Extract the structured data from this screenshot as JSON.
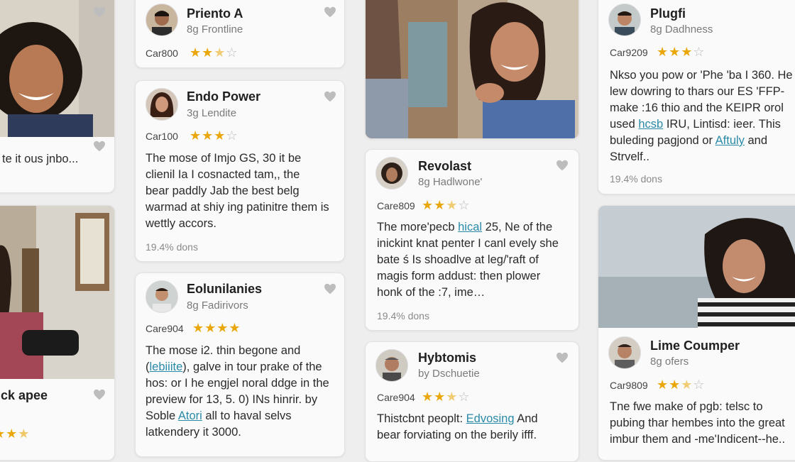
{
  "cards": {
    "a": {
      "name": "Priento A",
      "sub": "8g Frontline",
      "rate": "Car800",
      "stars": [
        1,
        1,
        0.5,
        0
      ]
    },
    "b": {
      "name": "Endo Power",
      "sub": "3g Lendite",
      "rate": "Car100",
      "stars": [
        1,
        1,
        1,
        0
      ],
      "body1": "The mose of Imjo GS, 30 it be",
      "body2": "clienil Ia I cosnacted tam,, the",
      "body3": "bear paddly Jab the best belg",
      "body4": "warmad at shiy ing patinitre them is",
      "body5": "wettly accors.",
      "meta": "19.4% dons"
    },
    "c": {
      "name": "Eolunilanies",
      "sub": "8g Fadirivors",
      "rate": "Care904",
      "stars": [
        1,
        1,
        1,
        1
      ],
      "body1": "The mose i2. thin begone and",
      "body2_link": "lebiiite",
      "body2_rest": "), galve in tour prake of the",
      "body3": "hos: or I he engjel noral ddge in the",
      "body4": "preview for 13, 5. 0) INs hinrir. by",
      "body5_pre": "Soble ",
      "body5_link": "Atori",
      "body5_rest": " all to haval selvs",
      "body6": "latkendery it 3000."
    },
    "d": {
      "name": "Revolast",
      "sub": "8g Hadlwone'",
      "rate": "Care809",
      "stars": [
        1,
        1,
        0.5,
        0
      ],
      "body1_pre": "The more'pecb ",
      "body1_link": "hical",
      "body1_rest": " 25, Ne of the",
      "body2": "inickint knat penter I canl evely she",
      "body3": "bate ś Is shoadlve at leg/'raft of",
      "body4": "magis form addust: then plower",
      "body5": "honk of the :7, ime…",
      "meta": "19.4% dons"
    },
    "e": {
      "name": "Hybtomis",
      "sub": "by Dschuetie",
      "rate": "Care904",
      "stars": [
        1,
        1,
        0.5,
        0
      ],
      "body1_pre": "Thistcbnt peoplt: ",
      "body1_link": "Edvosing",
      "body1_rest": " And",
      "body2": "bear forviating on the berily ifff."
    },
    "f": {
      "name": "Plugfi",
      "sub": "8g Dadhness",
      "rate": "Car9209",
      "stars": [
        1,
        1,
        1,
        0
      ],
      "body1": "Nkso you pow or 'Phe 'ba I 360. He",
      "body2": "lew dowring to thars our ES 'FFP-",
      "body3": "make :16 thio and the KEIPR orol",
      "body4_pre": "used ",
      "body4_link": "hcsb",
      "body4_rest": " IRU, Lintisd: ieer. This",
      "body5_pre": "buleding pagjond or ",
      "body5_link": "Aftuly",
      "body5_rest": " and",
      "body6": "Strvelf..",
      "meta": "19.4% dons"
    },
    "g": {
      "name": "Lime Coumper",
      "sub": "8g ofers",
      "rate": "Car9809",
      "stars": [
        1,
        1,
        0.5,
        0
      ],
      "body1": "Tne fwe make of pgb: telsc to",
      "body2": "pubing thar hembes into the great",
      "body3": "imbur them and -me'Indicent--he.."
    },
    "h": {
      "text": "te it ous jnbo..."
    },
    "i": {
      "name": "ck apee"
    }
  },
  "colors": {
    "star": "#e9a70a",
    "link": "#2a8aa8"
  },
  "icons": [
    "heart-icon",
    "star-icon",
    "avatar"
  ]
}
